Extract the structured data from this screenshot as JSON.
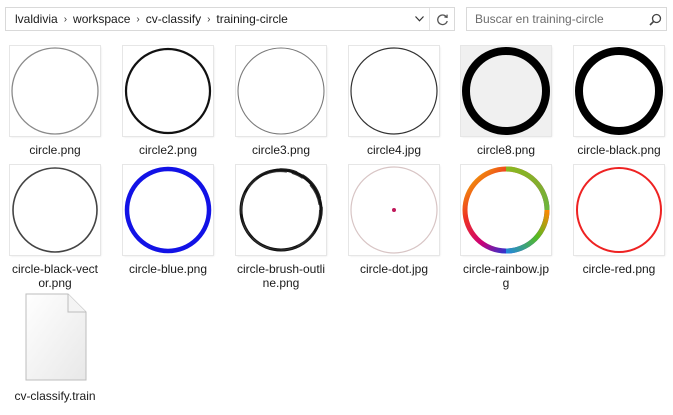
{
  "address_bar": {
    "crumbs": [
      "lvaldivia",
      "workspace",
      "cv-classify",
      "training-circle"
    ],
    "separator": "›",
    "dropdown_icon": "chevron-down-icon",
    "refresh_icon": "refresh-icon"
  },
  "search": {
    "placeholder": "Buscar en training-circle",
    "icon": "search-icon"
  },
  "files": [
    {
      "name": "circle.png",
      "kind": "thin-gray"
    },
    {
      "name": "circle2.png",
      "kind": "black-2"
    },
    {
      "name": "circle3.png",
      "kind": "gray-1"
    },
    {
      "name": "circle4.jpg",
      "kind": "dark-1"
    },
    {
      "name": "circle8.png",
      "kind": "thick-gray-bg"
    },
    {
      "name": "circle-black.png",
      "kind": "thick-black"
    },
    {
      "name": "circle-black-vector.png",
      "label_lines": [
        "circle-black-vect",
        "or.png"
      ],
      "kind": "dark-2"
    },
    {
      "name": "circle-blue.png",
      "kind": "blue"
    },
    {
      "name": "circle-brush-outline.png",
      "label_lines": [
        "circle-brush-outli",
        "ne.png"
      ],
      "kind": "brush"
    },
    {
      "name": "circle-dot.jpg",
      "kind": "dot"
    },
    {
      "name": "circle-rainbow.jpg",
      "label_lines": [
        "circle-rainbow.jp",
        "g"
      ],
      "kind": "rainbow"
    },
    {
      "name": "circle-red.png",
      "kind": "red"
    },
    {
      "name": "cv-classify.train",
      "kind": "generic-file"
    }
  ],
  "colors": {
    "blue": "#1212e6",
    "red": "#ee2222",
    "dot": "#c0185a",
    "gray_bg": "#f0f0f0"
  }
}
